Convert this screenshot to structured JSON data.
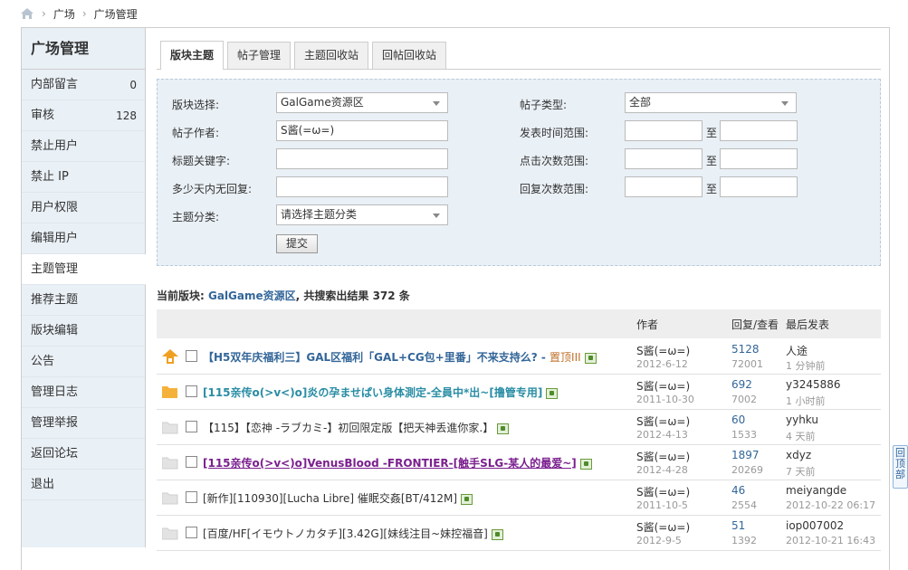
{
  "breadcrumb": {
    "items": [
      "广场",
      "广场管理"
    ]
  },
  "sidebar": {
    "title": "广场管理",
    "items": [
      {
        "label": "内部留言",
        "count": "0"
      },
      {
        "label": "审核",
        "count": "128"
      },
      {
        "label": "禁止用户",
        "count": ""
      },
      {
        "label": "禁止 IP",
        "count": ""
      },
      {
        "label": "用户权限",
        "count": ""
      },
      {
        "label": "编辑用户",
        "count": ""
      },
      {
        "label": "主题管理",
        "count": ""
      },
      {
        "label": "推荐主题",
        "count": ""
      },
      {
        "label": "版块编辑",
        "count": ""
      },
      {
        "label": "公告",
        "count": ""
      },
      {
        "label": "管理日志",
        "count": ""
      },
      {
        "label": "管理举报",
        "count": ""
      },
      {
        "label": "返回论坛",
        "count": ""
      },
      {
        "label": "退出",
        "count": ""
      }
    ]
  },
  "tabs": [
    "版块主题",
    "帖子管理",
    "主题回收站",
    "回帖回收站"
  ],
  "filter": {
    "board_label": "版块选择:",
    "board_value": "GalGame资源区",
    "type_label": "帖子类型:",
    "type_value": "全部",
    "author_label": "帖子作者:",
    "author_value": "S酱(=ω=)",
    "time_label": "发表时间范围:",
    "keyword_label": "标题关键字:",
    "click_label": "点击次数范围:",
    "noreply_label": "多少天内无回复:",
    "reply_label": "回复次数范围:",
    "category_label": "主题分类:",
    "category_value": "请选择主题分类",
    "to": "至",
    "submit": "提交"
  },
  "summary": {
    "prefix": "当前版块:",
    "board": "GalGame资源区",
    "suffix": ", 共搜索出结果 372 条"
  },
  "table": {
    "headers": {
      "author": "作者",
      "replies": "回复/查看",
      "last": "最后发表"
    },
    "rows": [
      {
        "title": "【H5双年庆福利三】GAL区福利「GAL+CG包+里番」不来支持么? - ",
        "tag": "置顶III",
        "style": "t-blue",
        "icon": "pin-up-icon",
        "author": "S酱(=ω=)",
        "date": "2012-6-12",
        "replies": "5128",
        "views": "72001",
        "last_user": "人途",
        "last_time": "1 分钟前"
      },
      {
        "title": "[115亲传o(>v<)o]炎の孕ませぱい身体測定-全員中*出~[撸管专用]",
        "tag": "",
        "style": "t-teal",
        "icon": "folder-hot-icon",
        "author": "S酱(=ω=)",
        "date": "2011-10-30",
        "replies": "692",
        "views": "7002",
        "last_user": "y3245886",
        "last_time": "1 小时前"
      },
      {
        "title": "【115】【恋神 -ラブカミ-】初回限定版【把天神丢進你家.】",
        "tag": "",
        "style": "t-normal",
        "icon": "folder-icon",
        "author": "S酱(=ω=)",
        "date": "2012-4-13",
        "replies": "60",
        "views": "1533",
        "last_user": "yyhku",
        "last_time": "4 天前"
      },
      {
        "title": "[115亲传o(>v<)o]VenusBlood -FRONTIER-[触手SLG-某人的最爱~]",
        "tag": "",
        "style": "t-purple",
        "icon": "folder-icon",
        "author": "S酱(=ω=)",
        "date": "2012-4-28",
        "replies": "1897",
        "views": "20269",
        "last_user": "xdyz",
        "last_time": "7 天前"
      },
      {
        "title": "[新作][110930][Lucha Libre] 催眠交姦[BT/412M]",
        "tag": "",
        "style": "t-normal",
        "icon": "folder-icon",
        "author": "S酱(=ω=)",
        "date": "2011-10-5",
        "replies": "46",
        "views": "2554",
        "last_user": "meiyangde",
        "last_time": "2012-10-22 06:17"
      },
      {
        "title": "[百度/HF[イモウトノカタチ][3.42G][妹线注目~妹控福音]",
        "tag": "",
        "style": "t-normal",
        "icon": "folder-icon",
        "author": "S酱(=ω=)",
        "date": "2012-9-5",
        "replies": "51",
        "views": "1392",
        "last_user": "iop007002",
        "last_time": "2012-10-21 16:43"
      }
    ]
  },
  "totop": "回顶部"
}
